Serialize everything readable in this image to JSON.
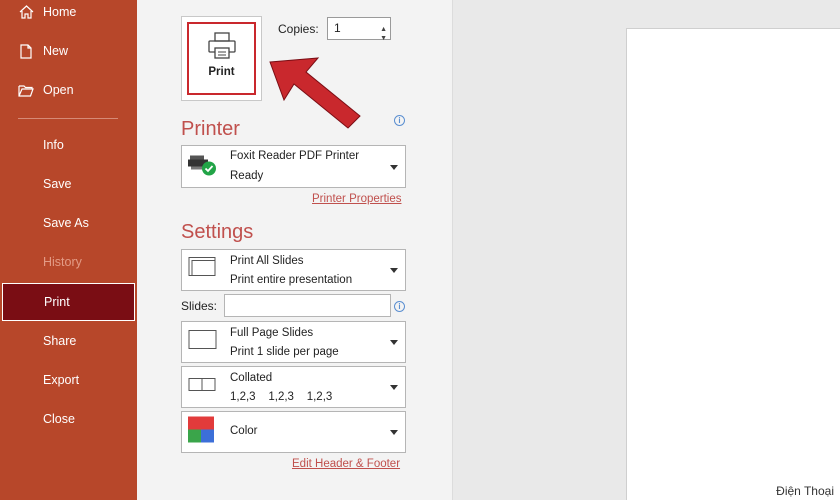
{
  "sidebar": {
    "items": [
      {
        "label": "Home",
        "icon": "home-icon"
      },
      {
        "label": "New",
        "icon": "new-document-icon"
      },
      {
        "label": "Open",
        "icon": "open-folder-icon"
      },
      {
        "label": "Info"
      },
      {
        "label": "Save"
      },
      {
        "label": "Save As"
      },
      {
        "label": "History",
        "state": "disabled"
      },
      {
        "label": "Print",
        "state": "selected"
      },
      {
        "label": "Share"
      },
      {
        "label": "Export"
      },
      {
        "label": "Close"
      }
    ]
  },
  "print": {
    "button_label": "Print",
    "copies_label": "Copies:",
    "copies_value": "1"
  },
  "printer": {
    "section_title": "Printer",
    "name": "Foxit Reader PDF Printer",
    "status": "Ready",
    "properties_link": "Printer Properties"
  },
  "settings": {
    "section_title": "Settings",
    "range_title": "Print All Slides",
    "range_subtitle": "Print entire presentation",
    "slides_label": "Slides:",
    "slides_value": "",
    "layout_title": "Full Page Slides",
    "layout_subtitle": "Print 1 slide per page",
    "collation_title": "Collated",
    "collation_subtitle": "1,2,3    1,2,3    1,2,3",
    "color_title": "Color",
    "header_footer_link": "Edit Header & Footer"
  },
  "watermark": "Điện Thoại",
  "colors": {
    "sidebar": "#b7472a",
    "sidebar_active": "#7a0d14",
    "accent": "#c0504d",
    "highlight_border": "#c9282d",
    "arrow": "#c9282d"
  }
}
